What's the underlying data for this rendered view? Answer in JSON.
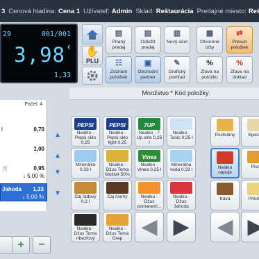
{
  "statusbar": {
    "id_tail": "3",
    "price_level_label": "Cenová hladina:",
    "price_level_value": "Cena 1",
    "user_label": "Užívateľ:",
    "user_value": "Admin",
    "warehouse_label": "Sklad:",
    "warehouse_value": "Reštaurácia",
    "sales_point_label": "Predajné miesto:",
    "sales_point_value": "Reštaurácia"
  },
  "display": {
    "top_left": "29",
    "top_right": "001/001",
    "main": "3,98",
    "currency": "€",
    "bottom_right": "1,33"
  },
  "mode_buttons": [
    {
      "icon": "home-icon",
      "label": ""
    },
    {
      "icon": "plu-icon",
      "label": "PLU"
    },
    {
      "icon": "gear-icon",
      "label": ""
    }
  ],
  "functions": [
    {
      "icon": "receipt-icon",
      "label1": "Prianý",
      "label2": "predaj",
      "glyph": "▤",
      "color": "#4a5a6e"
    },
    {
      "icon": "receipt-send-icon",
      "label1": "Odložit",
      "label2": "predaj",
      "glyph": "▤",
      "color": "#4a5a6e"
    },
    {
      "icon": "new-account-icon",
      "label1": "Nový účet",
      "label2": "",
      "glyph": "▥",
      "color": "#4a5a6e"
    },
    {
      "icon": "open-accounts-icon",
      "label1": "Otvorené",
      "label2": "účty",
      "glyph": "▦",
      "color": "#4a5a6e"
    },
    {
      "icon": "move-items-icon",
      "label1": "Presun",
      "label2": "položiek",
      "glyph": "⇄",
      "color": "#c0392b"
    },
    {
      "icon": "items-list-icon",
      "label1": "Zoznam",
      "label2": "položiek",
      "glyph": "☷",
      "color": "#2f5e9e"
    },
    {
      "icon": "business-partner-icon",
      "label1": "Obchodní",
      "label2": "partner",
      "glyph": "▣",
      "color": "#2f5e9e"
    },
    {
      "icon": "graphic-overview-icon",
      "label1": "Grafický",
      "label2": "prehľad",
      "glyph": "✎",
      "color": "#4a5a6e"
    },
    {
      "icon": "percent-icon",
      "label1": "Zľava na",
      "label2": "položku",
      "glyph": "%",
      "color": "#1e2a38"
    },
    {
      "icon": "percent-icon",
      "label1": "Zľava na",
      "label2": "doklad",
      "glyph": "%",
      "color": "#b03a2e"
    }
  ],
  "quantity_header": "Množstvo * Kód položky:",
  "receipt": {
    "count_label": "Počet: 4",
    "rows": [
      {
        "name": "l",
        "price": "0,70",
        "sub": ""
      },
      {
        "name": "",
        "price": "1,00",
        "sub": ""
      },
      {
        "name": "🗎",
        "price": "0,95",
        "sub": "↓ 5,00 %"
      }
    ],
    "selected": {
      "name": "Jahoda",
      "price": "1,33",
      "sub": "↓ 5,00 %"
    }
  },
  "bottom_buttons": [
    {
      "icon": "unknown-icon",
      "label": ""
    },
    {
      "icon": "plus-icon",
      "label": "+"
    },
    {
      "icon": "minus-icon",
      "label": "−"
    }
  ],
  "products": [
    {
      "line1": "Nealko -",
      "line2": "Pepsi sklo",
      "line3": "0,25",
      "brand": "PEPSI",
      "img_color": "#1d3f8f"
    },
    {
      "line1": "Nealko -",
      "line2": "Pepsi sklo",
      "line3": "light 0,25",
      "brand": "PEPSI",
      "img_color": "#1d3f8f"
    },
    {
      "line1": "Nealko - 7",
      "line2": "Up sklo 0,25",
      "line3": "l",
      "brand": "7UP",
      "img_color": "#1f8b3b"
    },
    {
      "line1": "Nealko -",
      "line2": "Tonic 0,25 l",
      "line3": "",
      "brand": "",
      "img_color": "#cfe3f5"
    },
    {
      "line1": "Minerálka",
      "line2": "0,33 l",
      "line3": "",
      "brand": "",
      "img_color": "#9fc9ef"
    },
    {
      "line1": "Nealko -",
      "line2": "Džus Toma",
      "line3": "Multivit 50%",
      "brand": "",
      "img_color": "#d9b23c"
    },
    {
      "line1": "Nealko -",
      "line2": "Vinea 0,25 l",
      "line3": "",
      "brand": "Vinea",
      "img_color": "#2f8a3b"
    },
    {
      "line1": "Minerálna",
      "line2": "voda 0,33 l",
      "line3": "",
      "brand": "",
      "img_color": "#a8d2f2"
    },
    {
      "line1": "Čaj ľadový",
      "line2": "0,2 l",
      "line3": "",
      "brand": "",
      "img_color": "#c68a3a"
    },
    {
      "line1": "Čaj čierny",
      "line2": "",
      "line3": "",
      "brand": "",
      "img_color": "#5a3a24"
    },
    {
      "line1": "Nealko -",
      "line2": "Džus",
      "line3": "pomaranč...",
      "brand": "",
      "img_color": "#f0922f"
    },
    {
      "line1": "Nealko -",
      "line2": "Džus",
      "line3": "Jahoda",
      "brand": "",
      "img_color": "#d6373f"
    },
    {
      "line1": "Nealko -",
      "line2": "Džus Toma",
      "line3": "ríbezľový",
      "brand": "",
      "img_color": "#2a2a2a"
    },
    {
      "line1": "Nealko -",
      "line2": "Džus Toma",
      "line3": "Grep",
      "brand": "",
      "img_color": "#e6a13a"
    }
  ],
  "product_nav": {
    "prev_icon": "arrow-left-icon",
    "next_icon": "arrow-right-icon"
  },
  "categories": [
    {
      "label": "Pochutiny",
      "img_color": "#e6b34a"
    },
    {
      "label": "Special",
      "img_color": "#e6d8a8"
    },
    {
      "label": "Nealko",
      "label2": "nápoje",
      "img_color": "#d23a2a"
    },
    {
      "label": "Pivo",
      "img_color": "#e0a030"
    },
    {
      "label": "Káva",
      "img_color": "#8a5a2e"
    },
    {
      "label": "Prílohy",
      "img_color": "#e8d480"
    }
  ],
  "category_nav": {
    "prev_icon": "arrow-left-icon",
    "next_icon": "arrow-right-icon"
  }
}
